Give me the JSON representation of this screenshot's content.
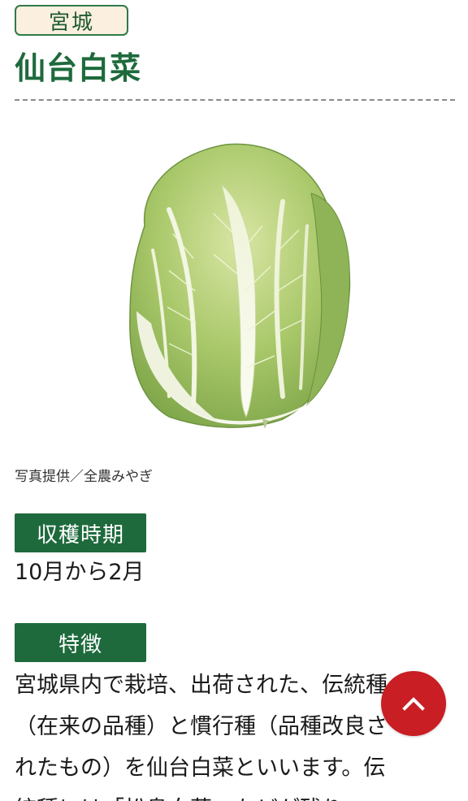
{
  "header": {
    "prefecture": "宮城",
    "title": "仙台白菜"
  },
  "photo": {
    "alt": "仙台白菜",
    "credit": "写真提供／全農みやぎ"
  },
  "harvest": {
    "label": "収穫時期",
    "value": "10月から2月"
  },
  "features": {
    "label": "特徴",
    "lines": [
      "宮城県内で栽培、出荷された、伝統種",
      "（在来の品種）と慣行種（品種改良さ",
      "れたもの）を仙台白菜といいます。伝",
      "統種には「松島白菜」などが残り"
    ]
  },
  "colors": {
    "brand_green": "#1e6a3c",
    "badge_bg": "#fbefdf",
    "scroll_button": "#c81e24"
  },
  "scroll_top": {
    "icon": "chevron-up-icon"
  }
}
